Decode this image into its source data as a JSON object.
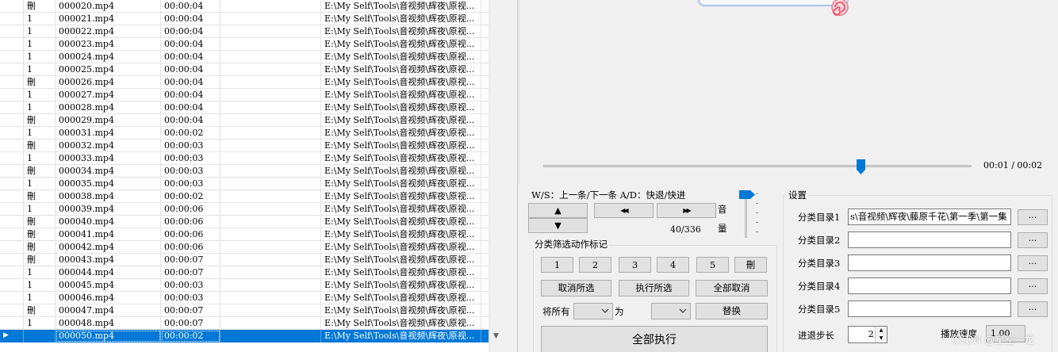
{
  "grid": {
    "rows": [
      {
        "flag": "刪",
        "name": "000020.mp4",
        "duration": "00:00:04",
        "path": "E:\\My Self\\Tools\\音视频\\辉夜\\原视..."
      },
      {
        "flag": "1",
        "name": "000021.mp4",
        "duration": "00:00:04",
        "path": "E:\\My Self\\Tools\\音视频\\辉夜\\原视..."
      },
      {
        "flag": "1",
        "name": "000022.mp4",
        "duration": "00:00:04",
        "path": "E:\\My Self\\Tools\\音视频\\辉夜\\原视..."
      },
      {
        "flag": "1",
        "name": "000023.mp4",
        "duration": "00:00:04",
        "path": "E:\\My Self\\Tools\\音视频\\辉夜\\原视..."
      },
      {
        "flag": "1",
        "name": "000024.mp4",
        "duration": "00:00:04",
        "path": "E:\\My Self\\Tools\\音视频\\辉夜\\原视..."
      },
      {
        "flag": "1",
        "name": "000025.mp4",
        "duration": "00:00:04",
        "path": "E:\\My Self\\Tools\\音视频\\辉夜\\原视..."
      },
      {
        "flag": "刪",
        "name": "000026.mp4",
        "duration": "00:00:04",
        "path": "E:\\My Self\\Tools\\音视频\\辉夜\\原视..."
      },
      {
        "flag": "1",
        "name": "000027.mp4",
        "duration": "00:00:04",
        "path": "E:\\My Self\\Tools\\音视频\\辉夜\\原视..."
      },
      {
        "flag": "1",
        "name": "000028.mp4",
        "duration": "00:00:04",
        "path": "E:\\My Self\\Tools\\音视频\\辉夜\\原视..."
      },
      {
        "flag": "刪",
        "name": "000029.mp4",
        "duration": "00:00:04",
        "path": "E:\\My Self\\Tools\\音视频\\辉夜\\原视..."
      },
      {
        "flag": "1",
        "name": "000031.mp4",
        "duration": "00:00:02",
        "path": "E:\\My Self\\Tools\\音视频\\辉夜\\原视..."
      },
      {
        "flag": "刪",
        "name": "000032.mp4",
        "duration": "00:00:03",
        "path": "E:\\My Self\\Tools\\音视频\\辉夜\\原视..."
      },
      {
        "flag": "1",
        "name": "000033.mp4",
        "duration": "00:00:03",
        "path": "E:\\My Self\\Tools\\音视频\\辉夜\\原视..."
      },
      {
        "flag": "刪",
        "name": "000034.mp4",
        "duration": "00:00:03",
        "path": "E:\\My Self\\Tools\\音视频\\辉夜\\原视..."
      },
      {
        "flag": "1",
        "name": "000035.mp4",
        "duration": "00:00:03",
        "path": "E:\\My Self\\Tools\\音视频\\辉夜\\原视..."
      },
      {
        "flag": "刪",
        "name": "000038.mp4",
        "duration": "00:00:02",
        "path": "E:\\My Self\\Tools\\音视频\\辉夜\\原视..."
      },
      {
        "flag": "1",
        "name": "000039.mp4",
        "duration": "00:00:06",
        "path": "E:\\My Self\\Tools\\音视频\\辉夜\\原视..."
      },
      {
        "flag": "刪",
        "name": "000040.mp4",
        "duration": "00:00:06",
        "path": "E:\\My Self\\Tools\\音视频\\辉夜\\原视..."
      },
      {
        "flag": "刪",
        "name": "000041.mp4",
        "duration": "00:00:06",
        "path": "E:\\My Self\\Tools\\音视频\\辉夜\\原视..."
      },
      {
        "flag": "刪",
        "name": "000042.mp4",
        "duration": "00:00:06",
        "path": "E:\\My Self\\Tools\\音视频\\辉夜\\原视..."
      },
      {
        "flag": "刪",
        "name": "000043.mp4",
        "duration": "00:00:07",
        "path": "E:\\My Self\\Tools\\音视频\\辉夜\\原视..."
      },
      {
        "flag": "1",
        "name": "000044.mp4",
        "duration": "00:00:07",
        "path": "E:\\My Self\\Tools\\音视频\\辉夜\\原视..."
      },
      {
        "flag": "1",
        "name": "000045.mp4",
        "duration": "00:00:03",
        "path": "E:\\My Self\\Tools\\音视频\\辉夜\\原视..."
      },
      {
        "flag": "1",
        "name": "000046.mp4",
        "duration": "00:00:03",
        "path": "E:\\My Self\\Tools\\音视频\\辉夜\\原视..."
      },
      {
        "flag": "刪",
        "name": "000047.mp4",
        "duration": "00:00:07",
        "path": "E:\\My Self\\Tools\\音视频\\辉夜\\原视..."
      },
      {
        "flag": "1",
        "name": "000048.mp4",
        "duration": "00:00:07",
        "path": "E:\\My Self\\Tools\\音视频\\辉夜\\原视..."
      },
      {
        "flag": "",
        "name": "000050.mp4",
        "duration": "00:00:02",
        "path": "E:\\My Self\\Tools\\音视频\\辉夜\\原视...",
        "selected": true,
        "indicator": "▶"
      }
    ]
  },
  "player": {
    "time": "00:01 / 00:02",
    "seek_fraction": 0.74,
    "volume_fraction": 1.0
  },
  "controls": {
    "hint": "W/S：上一条/下一条 A/D：快退/快进",
    "up": "▲",
    "down": "▼",
    "rewind": "◀◀",
    "forward": "▶▶",
    "counter": "40/336",
    "volume_label": "音量"
  },
  "classify": {
    "title": "分类筛选动作标记",
    "actions": [
      "1",
      "2",
      "3",
      "4",
      "5",
      "刪"
    ],
    "cancel_selected": "取消所选",
    "execute_selected": "执行所选",
    "cancel_all": "全部取消",
    "all_label": "将所有",
    "to_label": "为",
    "replace": "替换",
    "execute_all": "全部执行"
  },
  "settings": {
    "title": "设置",
    "dirs": [
      {
        "label": "分类目录1",
        "value": "s\\音视频\\辉夜\\藤原千花\\第一季\\第一集"
      },
      {
        "label": "分类目录2",
        "value": ""
      },
      {
        "label": "分类目录3",
        "value": ""
      },
      {
        "label": "分类目录4",
        "value": ""
      },
      {
        "label": "分类目录5",
        "value": ""
      }
    ],
    "browse": "...",
    "step_label": "进退步长",
    "step_value": "2",
    "speed_label": "播放速度",
    "speed_value": "1.00"
  },
  "watermark": "CSDN @星空~龙",
  "colors": {
    "selection": "#0078d7",
    "button_face": "#e1e1e1",
    "slider_thumb": "#0078d7"
  }
}
